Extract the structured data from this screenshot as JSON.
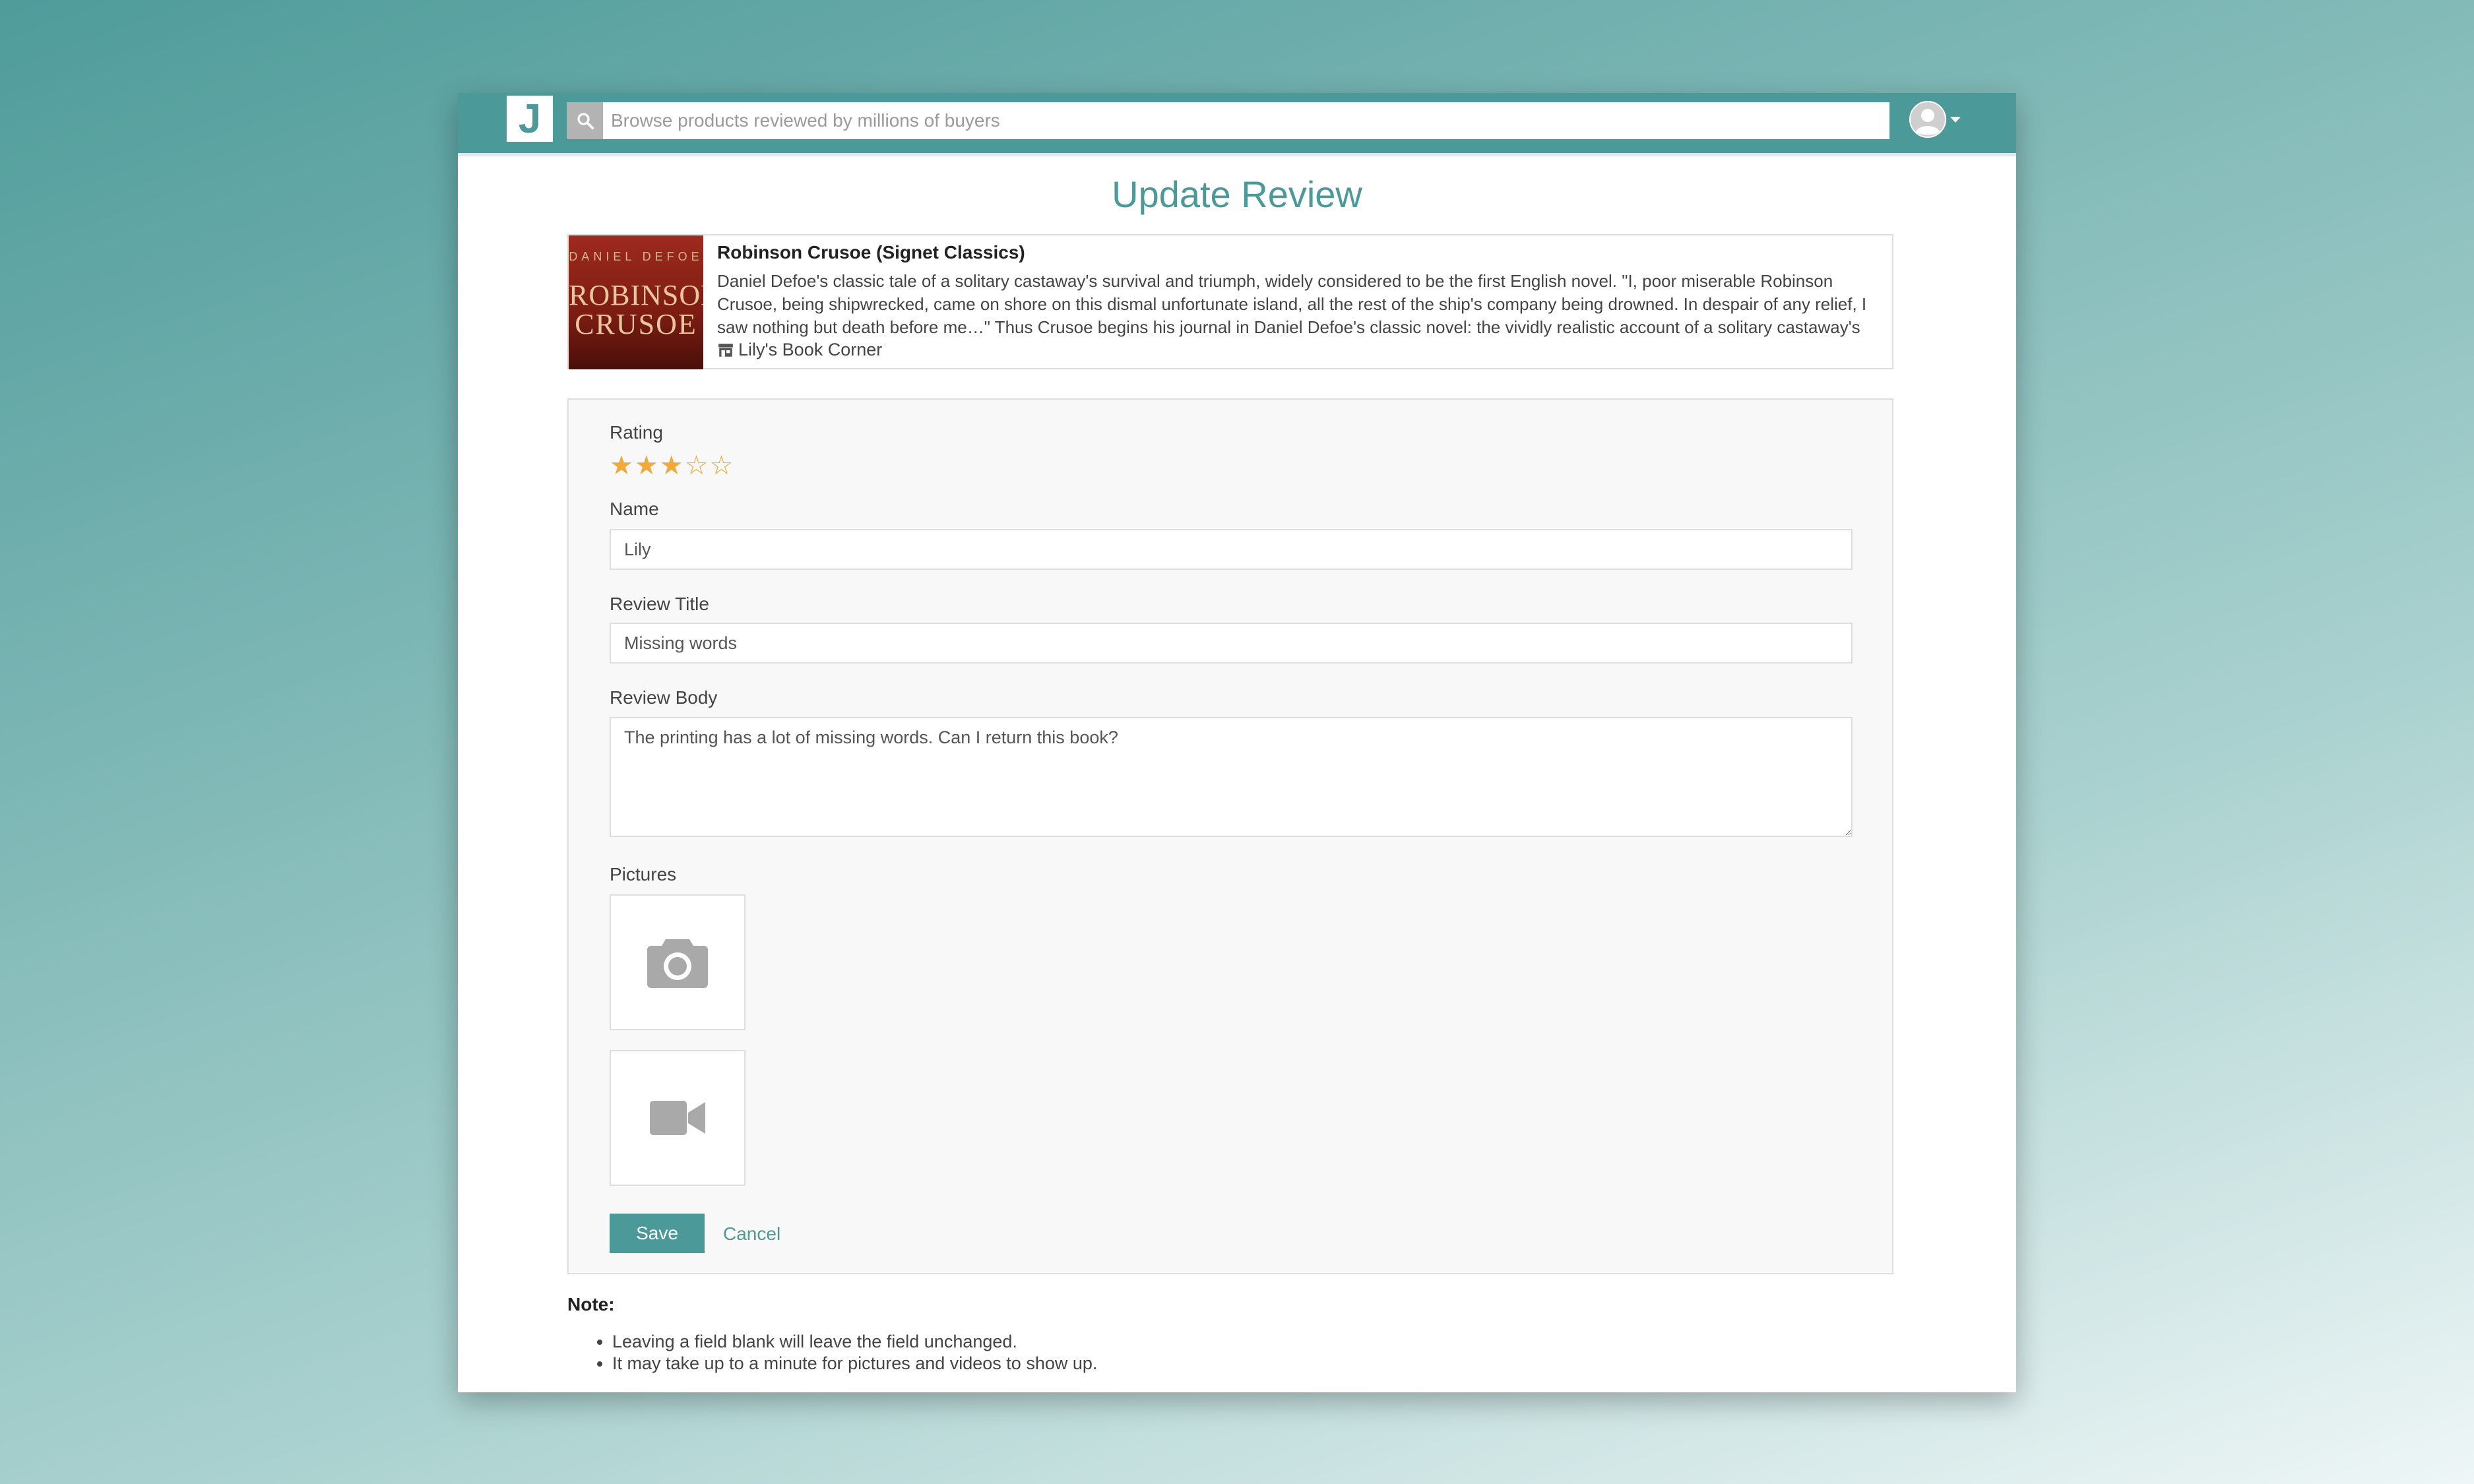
{
  "navbar": {
    "logo_text": "J",
    "search_placeholder": "Browse products reviewed by millions of buyers",
    "search_icon": "search-icon",
    "account_icon": "user-avatar-icon"
  },
  "page": {
    "title": "Update Review"
  },
  "product": {
    "name": "Robinson Crusoe (Signet Classics)",
    "description": "Daniel Defoe's classic tale of a solitary castaway's survival and triumph, widely considered to be the first English novel. \"I, poor miserable Robinson Crusoe, being shipwrecked, came on shore on this dismal unfortunate island, all the rest of the ship's company being drowned. In despair of any relief, I saw nothing but death before me…\" Thus Crusoe begins his journal in Daniel Defoe's classic novel: the vividly realistic account of a solitary castaway's triumph",
    "seller": "Lily's Book Corner",
    "cover": {
      "author": "DANIEL DEFOE",
      "title_line1": "ROBINSON",
      "title_line2": "CRUSOE"
    }
  },
  "form": {
    "rating_label": "Rating",
    "rating_value": 3,
    "rating_max": 5,
    "name_label": "Name",
    "name_value": "Lily",
    "title_label": "Review Title",
    "title_value": "Missing words",
    "body_label": "Review Body",
    "body_value": "The printing has a lot of missing words. Can I return this book?",
    "pictures_label": "Pictures",
    "photo_upload_icon": "camera-icon",
    "video_upload_icon": "video-camera-icon",
    "save_label": "Save",
    "cancel_label": "Cancel"
  },
  "note": {
    "heading": "Note:",
    "items": [
      "Leaving a field blank will leave the field unchanged.",
      "It may take up to a minute for pictures and videos to show up."
    ]
  },
  "colors": {
    "accent": "#4b9a99",
    "star": "#f0a93a",
    "background_gradient_start": "#4f9c9b",
    "background_gradient_end": "#eef6f6"
  }
}
